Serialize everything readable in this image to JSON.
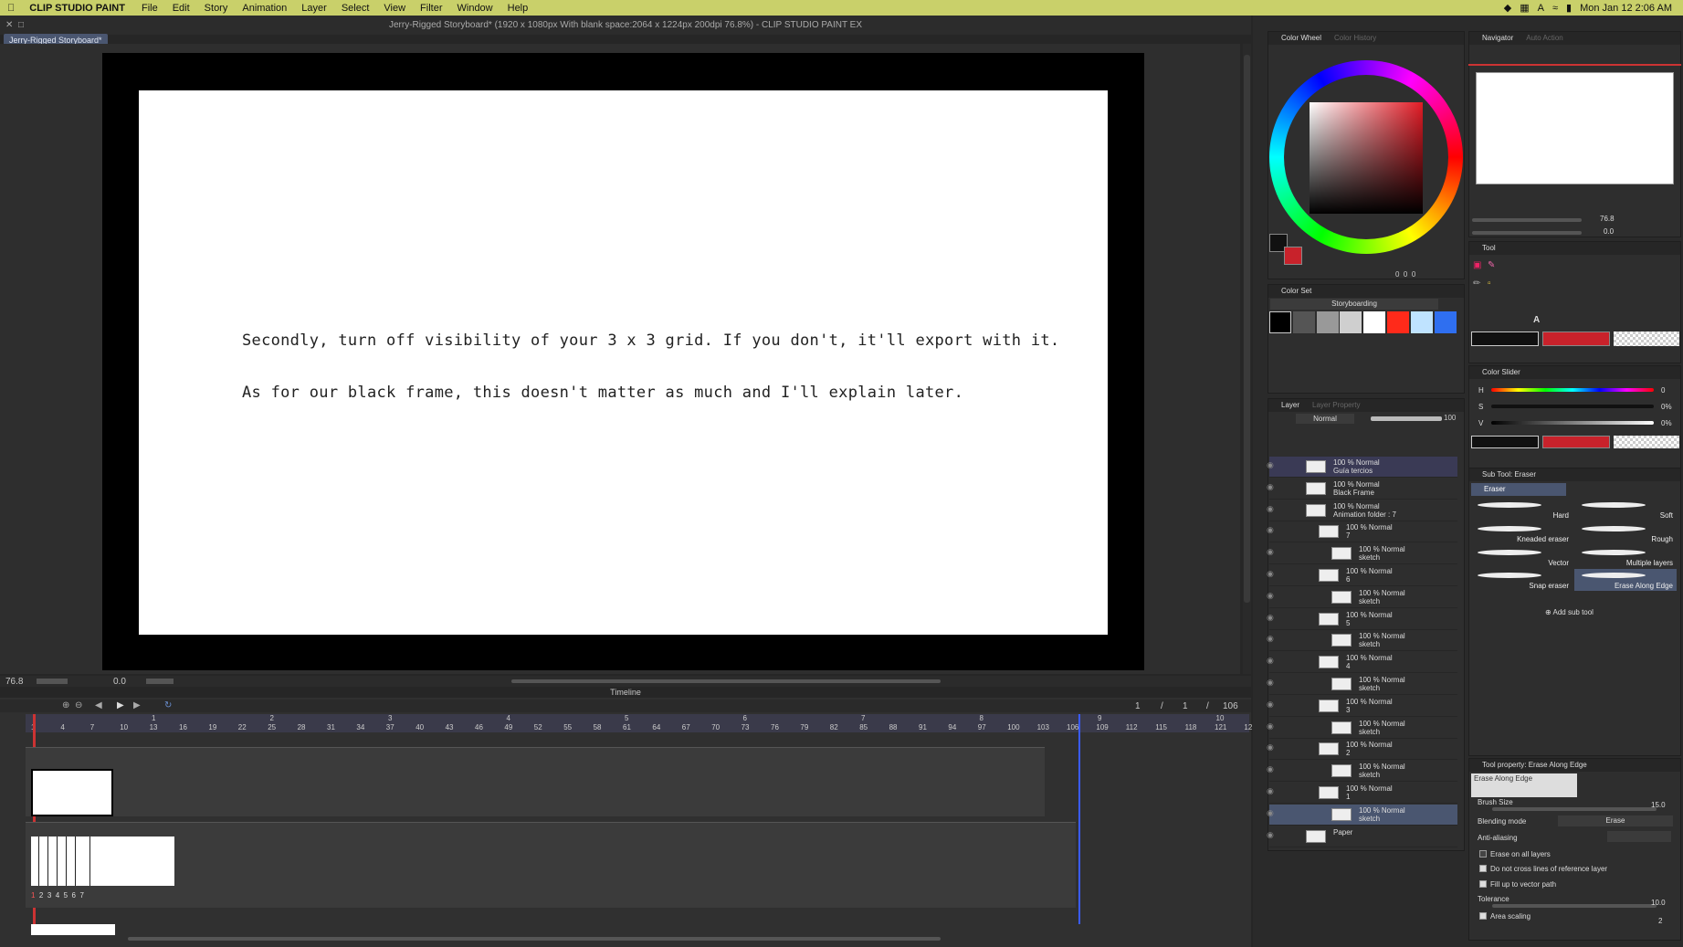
{
  "menubar": {
    "app": "CLIP STUDIO PAINT",
    "items": [
      "File",
      "Edit",
      "Story",
      "Animation",
      "Layer",
      "Select",
      "View",
      "Filter",
      "Window",
      "Help"
    ],
    "clock": "Mon Jan 12  2:06 AM"
  },
  "window": {
    "title": "Jerry-Rigged Storyboard* (1920 x 1080px With blank space:2064 x 1224px 200dpi 76.8%)  - CLIP STUDIO PAINT EX",
    "tab": "Jerry-Rigged Storyboard*"
  },
  "canvas": {
    "line1": "Secondly, turn off visibility of your 3 x 3 grid. If you don't, it'll export with it.",
    "line2": "As for our black frame, this doesn't matter as much and I'll explain later.",
    "zoom": "76.8",
    "angle": "0.0"
  },
  "timeline": {
    "title": "Timeline",
    "frame_counter": [
      "1",
      "/",
      "1",
      "/",
      "106"
    ],
    "ruler_top": [
      "1",
      "2",
      "3",
      "4",
      "5",
      "6",
      "7",
      "8",
      "9",
      "10"
    ],
    "ruler_frames": [
      "1",
      "4",
      "7",
      "10",
      "13",
      "16",
      "19",
      "22",
      "25",
      "28",
      "31",
      "34",
      "37",
      "40",
      "43",
      "46",
      "49",
      "52",
      "55",
      "58",
      "61",
      "64",
      "67",
      "70",
      "73",
      "76",
      "79",
      "82",
      "85",
      "88",
      "91",
      "94",
      "97",
      "100",
      "103",
      "106",
      "109",
      "112",
      "115",
      "118",
      "121",
      "12"
    ],
    "cel_numbers": [
      "1",
      "2",
      "3",
      "4",
      "5",
      "6",
      "7"
    ]
  },
  "color_wheel": {
    "tab": "Color Wheel",
    "tab_alt": "Color History",
    "values": [
      "0",
      "0",
      "0"
    ],
    "main_color": "#111111",
    "sub_color": "#c8222b"
  },
  "color_set": {
    "tab": "Color Set",
    "set_name": "Storyboarding",
    "swatches": [
      "#000000",
      "#555555",
      "#999999",
      "#cfcfcf",
      "#ffffff",
      "#ff2a1a",
      "#bfe3ff",
      "#2f6ff0"
    ]
  },
  "navigator": {
    "tab": "Navigator",
    "tab_alt": "Auto Action",
    "zoom": "76.8",
    "angle": "0.0"
  },
  "tool": {
    "tab": "Tool"
  },
  "color_slider": {
    "tab": "Color Slider",
    "h_label": "H",
    "h_val": "0",
    "s_label": "S",
    "s_val": "0%",
    "v_label": "V",
    "v_val": "0%"
  },
  "layer_panel": {
    "tab": "Layer",
    "tab_alt": "Layer Property",
    "blend": "Normal",
    "opacity": "100",
    "layers": [
      {
        "l1": "100 % Normal",
        "l2": "Guía tercios",
        "indent": 0,
        "selected": false
      },
      {
        "l1": "100 % Normal",
        "l2": "Black Frame",
        "indent": 0,
        "selected": false
      },
      {
        "l1": "100 % Normal",
        "l2": "Animation folder : 7",
        "indent": 0,
        "selected": false
      },
      {
        "l1": "100 % Normal",
        "l2": "7",
        "indent": 1,
        "selected": false
      },
      {
        "l1": "100 % Normal",
        "l2": "sketch",
        "indent": 2,
        "selected": false
      },
      {
        "l1": "100 % Normal",
        "l2": "6",
        "indent": 1,
        "selected": false
      },
      {
        "l1": "100 % Normal",
        "l2": "sketch",
        "indent": 2,
        "selected": false
      },
      {
        "l1": "100 % Normal",
        "l2": "5",
        "indent": 1,
        "selected": false
      },
      {
        "l1": "100 % Normal",
        "l2": "sketch",
        "indent": 2,
        "selected": false
      },
      {
        "l1": "100 % Normal",
        "l2": "4",
        "indent": 1,
        "selected": false
      },
      {
        "l1": "100 % Normal",
        "l2": "sketch",
        "indent": 2,
        "selected": false
      },
      {
        "l1": "100 % Normal",
        "l2": "3",
        "indent": 1,
        "selected": false
      },
      {
        "l1": "100 % Normal",
        "l2": "sketch",
        "indent": 2,
        "selected": false
      },
      {
        "l1": "100 % Normal",
        "l2": "2",
        "indent": 1,
        "selected": false
      },
      {
        "l1": "100 % Normal",
        "l2": "sketch",
        "indent": 2,
        "selected": false
      },
      {
        "l1": "100 % Normal",
        "l2": "1",
        "indent": 1,
        "selected": false
      },
      {
        "l1": "100 % Normal",
        "l2": "sketch",
        "indent": 2,
        "selected": true
      },
      {
        "l1": "",
        "l2": "Paper",
        "indent": 0,
        "selected": false
      }
    ]
  },
  "sub_tool": {
    "tab": "Sub Tool: Eraser",
    "group": "Eraser",
    "items": [
      "Hard",
      "Soft",
      "Kneaded eraser",
      "Rough",
      "Vector",
      "Multiple layers",
      "Snap eraser",
      "Erase Along Edge"
    ],
    "add": "Add sub tool"
  },
  "tool_property": {
    "tab": "Tool property: Erase Along Edge",
    "preset": "Erase Along Edge",
    "brush_size_label": "Brush Size",
    "brush_size": "15.0",
    "blending_label": "Blending mode",
    "blending": "Erase",
    "anti_alias_label": "Anti-aliasing",
    "erase_all": "Erase on all layers",
    "no_cross": "Do not cross lines of reference layer",
    "fill_up": "Fill up to vector path",
    "tolerance_label": "Tolerance",
    "tolerance": "10.0",
    "area_scaling": "Area scaling",
    "area_val": "2"
  }
}
